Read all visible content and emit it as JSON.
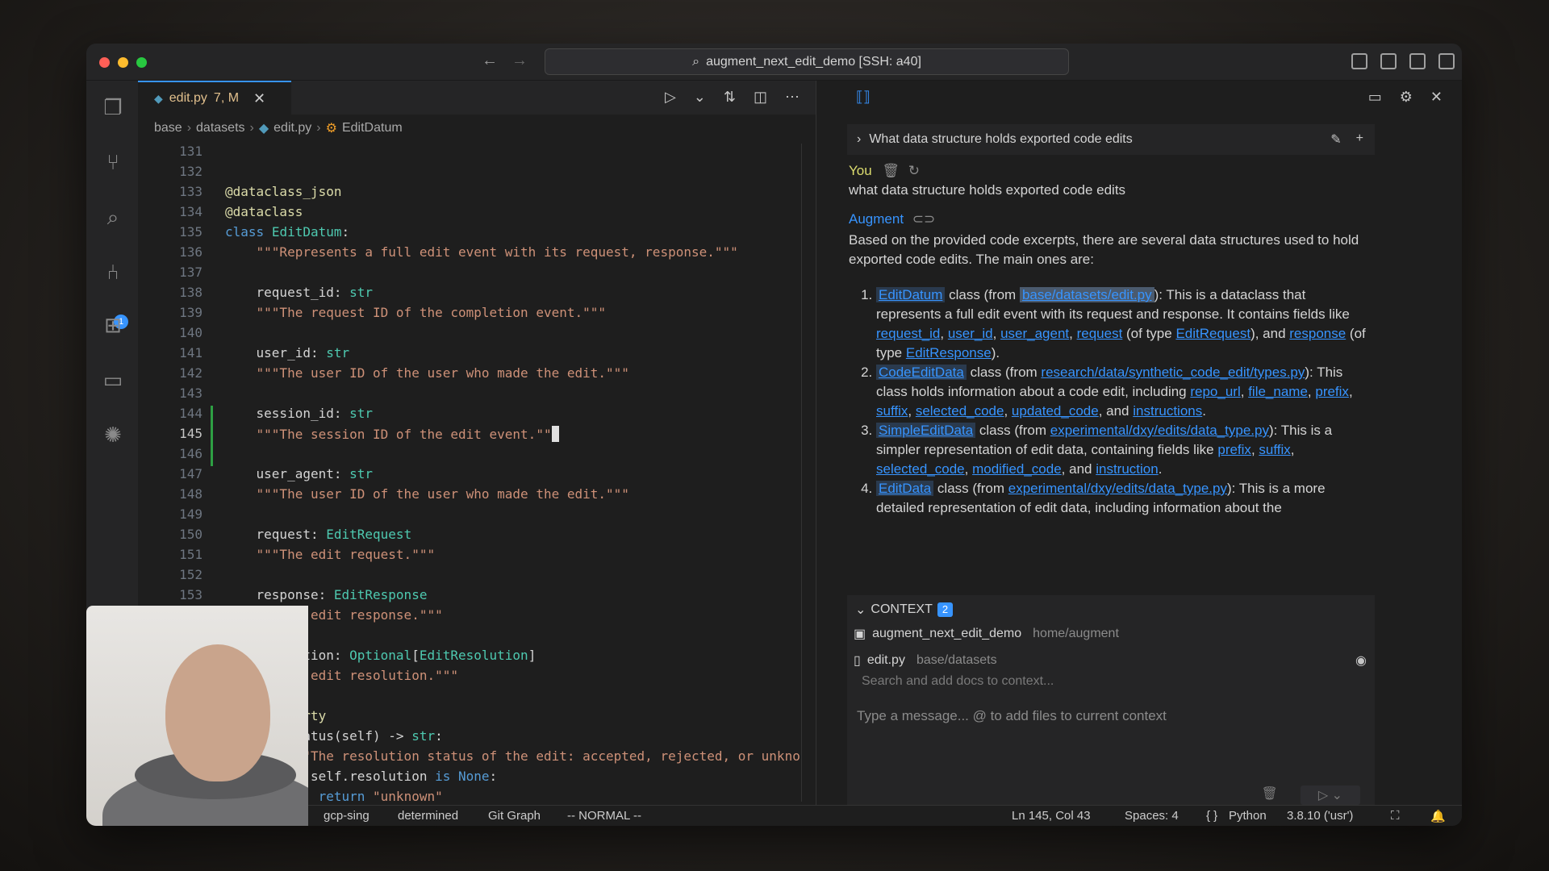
{
  "titlebar": {
    "search_text": "augment_next_edit_demo [SSH: a40]"
  },
  "editor": {
    "tab": {
      "label": "edit.py",
      "status": "7, M"
    },
    "breadcrumb": [
      "base",
      "datasets",
      "edit.py",
      "EditDatum"
    ],
    "cursor_line": "145",
    "lines": [
      {
        "n": "131",
        "text": ""
      },
      {
        "n": "132",
        "text": ""
      },
      {
        "n": "133",
        "text": "@dataclass_json"
      },
      {
        "n": "134",
        "text": "@dataclass"
      },
      {
        "n": "135",
        "text": "class EditDatum:"
      },
      {
        "n": "136",
        "text": "    \"\"\"Represents a full edit event with its request, response.\"\"\""
      },
      {
        "n": "137",
        "text": ""
      },
      {
        "n": "138",
        "text": "    request_id: str"
      },
      {
        "n": "139",
        "text": "    \"\"\"The request ID of the completion event.\"\"\""
      },
      {
        "n": "140",
        "text": ""
      },
      {
        "n": "141",
        "text": "    user_id: str"
      },
      {
        "n": "142",
        "text": "    \"\"\"The user ID of the user who made the edit.\"\"\""
      },
      {
        "n": "143",
        "text": ""
      },
      {
        "n": "144",
        "text": "    session_id: str"
      },
      {
        "n": "145",
        "text": "    \"\"\"The session ID of the edit event.\"\""
      },
      {
        "n": "146",
        "text": ""
      },
      {
        "n": "147",
        "text": "    user_agent: str"
      },
      {
        "n": "148",
        "text": "    \"\"\"The user ID of the user who made the edit.\"\"\""
      },
      {
        "n": "149",
        "text": ""
      },
      {
        "n": "150",
        "text": "    request: EditRequest"
      },
      {
        "n": "151",
        "text": "    \"\"\"The edit request.\"\"\""
      },
      {
        "n": "152",
        "text": ""
      },
      {
        "n": "153",
        "text": "    response: EditResponse"
      },
      {
        "n": "",
        "text": "    \"\"\"The edit response.\"\"\""
      },
      {
        "n": "",
        "text": ""
      },
      {
        "n": "",
        "text": "    resolution: Optional[EditResolution]"
      },
      {
        "n": "",
        "text": "    \"\"\"The edit resolution.\"\"\""
      },
      {
        "n": "",
        "text": ""
      },
      {
        "n": "",
        "text": "    @property"
      },
      {
        "n": "",
        "text": "    def status(self) -> str:"
      },
      {
        "n": "",
        "text": "        \"\"\"The resolution status of the edit: accepted, rejected, or unknown.\"\"\""
      },
      {
        "n": "",
        "text": "        if self.resolution is None:"
      },
      {
        "n": "",
        "text": "            return \"unknown\""
      }
    ]
  },
  "chat": {
    "thread_title": "What data structure holds exported code edits",
    "you_label": "You",
    "user_message": "what data structure holds exported code edits",
    "augment_label": "Augment",
    "intro": "Based on the provided code excerpts, there are several data structures used to hold exported code edits. The main ones are:",
    "items": [
      {
        "name": "EditDatum",
        "source": "base/datasets/edit.py",
        "desc_a": "): This is a dataclass that represents a full edit event with its request and response. It contains fields like ",
        "fields": [
          "request_id",
          "user_id",
          "user_agent",
          "request"
        ],
        "desc_b": " (of type ",
        "type_a": "EditRequest",
        "desc_c": "), and ",
        "field_last": "response",
        "desc_d": " (of type ",
        "type_b": "EditResponse",
        "desc_e": ")."
      },
      {
        "name": "CodeEditData",
        "source": "research/data/synthetic_code_edit/types.py",
        "desc": "): This class holds information about a code edit, including ",
        "fields": [
          "repo_url",
          "file_name",
          "prefix",
          "suffix",
          "selected_code",
          "updated_code"
        ],
        "and_text": ", and ",
        "last": "instructions",
        "end": "."
      },
      {
        "name": "SimpleEditData",
        "source": "experimental/dxy/edits/data_type.py",
        "desc": "): This is a simpler representation of edit data, containing fields like ",
        "fields": [
          "prefix",
          "suffix",
          "selected_code",
          "modified_code"
        ],
        "and_text": ", and ",
        "last": "instruction",
        "end": "."
      },
      {
        "name": "EditData",
        "source": "experimental/dxy/edits/data_type.py",
        "desc": "): This is a more detailed representation of edit data, including information about the"
      }
    ],
    "class_from": " class (from ",
    "context": {
      "label": "CONTEXT",
      "count": "2",
      "workspace": {
        "name": "augment_next_edit_demo",
        "path": "home/augment"
      },
      "file": {
        "name": "edit.py",
        "path": "base/datasets"
      },
      "search_placeholder": "Search and add docs to context...",
      "message_placeholder": "Type a message... @ to add files to current context"
    }
  },
  "statusbar": {
    "items": [
      "gcp-sing",
      "determined",
      "Git Graph",
      "-- NORMAL --"
    ],
    "position": "Ln 145, Col 43",
    "spaces": "Spaces: 4",
    "braces": "{ }",
    "language": "Python",
    "interpreter": "3.8.10 ('usr')"
  },
  "colors": {
    "accent": "#3794ff",
    "you_label": "#dcdc6e",
    "string": "#ce9178",
    "keyword": "#569cd6",
    "class": "#4ec9b0",
    "decorator": "#dcdcaa"
  }
}
